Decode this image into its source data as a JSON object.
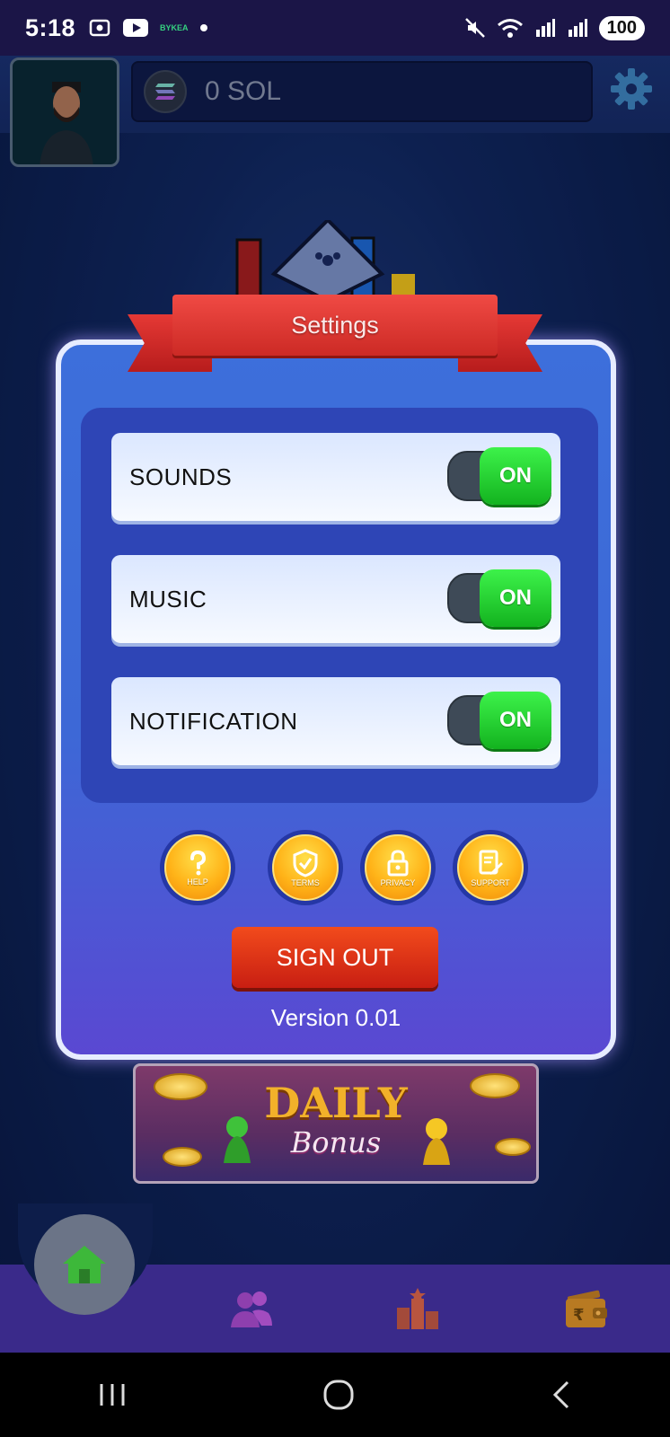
{
  "status_bar": {
    "time": "5:18",
    "carrier_badge": "BYKEA",
    "battery": "100"
  },
  "header": {
    "balance": "0 SOL"
  },
  "settings_dialog": {
    "title": "Settings",
    "rows": [
      {
        "label": "SOUNDS",
        "state": "ON"
      },
      {
        "label": "MUSIC",
        "state": "ON"
      },
      {
        "label": "NOTIFICATION",
        "state": "ON"
      }
    ],
    "links": [
      {
        "label": "HELP",
        "icon": "question-icon"
      },
      {
        "label": "TERMS",
        "icon": "shield-check-icon"
      },
      {
        "label": "PRIVACY",
        "icon": "lock-icon"
      },
      {
        "label": "SUPPORT",
        "icon": "edit-document-icon"
      }
    ],
    "sign_out": "SIGN OUT",
    "version": "Version 0.01"
  },
  "banner": {
    "title": "DAILY",
    "subtitle": "Bonus"
  },
  "bottom_nav": {
    "items": [
      "home-icon",
      "friends-icon",
      "leaderboard-icon",
      "wallet-icon"
    ]
  },
  "colors": {
    "accent_green": "#19c42a",
    "ribbon_red": "#e53935",
    "panel_blue": "#3d6fdb",
    "nav_purple": "#3a2a8a"
  }
}
